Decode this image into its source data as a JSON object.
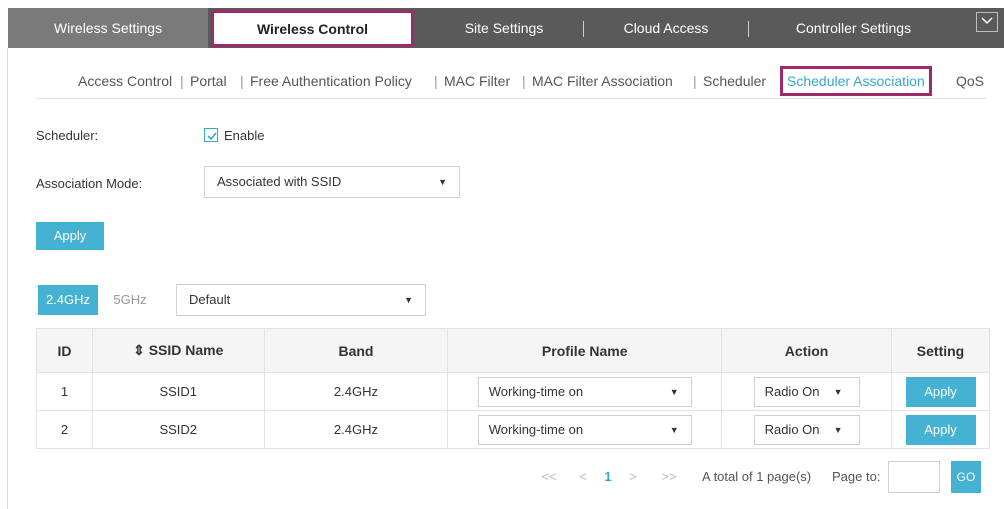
{
  "top_tabs": {
    "wireless_settings": "Wireless Settings",
    "wireless_control": "Wireless Control",
    "site_settings": "Site Settings",
    "cloud_access": "Cloud Access",
    "controller_settings": "Controller Settings",
    "expand_icon": "chevron-down-icon"
  },
  "sub_nav": {
    "items": [
      "Access Control",
      "Portal",
      "Free Authentication Policy",
      "MAC Filter",
      "MAC Filter Association",
      "Scheduler",
      "Scheduler Association",
      "QoS"
    ],
    "separator": "|",
    "active": "Scheduler Association"
  },
  "form": {
    "scheduler_label": "Scheduler:",
    "enable_label": "Enable",
    "enable_checked": true,
    "association_mode_label": "Association Mode:",
    "association_mode_value": "Associated with SSID",
    "apply_label": "Apply"
  },
  "band_tabs": {
    "tab_24": "2.4GHz",
    "tab_5": "5GHz",
    "active": "2.4GHz",
    "group_select": "Default"
  },
  "table": {
    "headers": {
      "id": "ID",
      "ssid_name": "SSID Name",
      "sort_icon": "sort-icon",
      "band": "Band",
      "profile_name": "Profile Name",
      "action": "Action",
      "setting": "Setting"
    },
    "rows": [
      {
        "id": "1",
        "ssid": "SSID1",
        "band": "2.4GHz",
        "profile": "Working-time on",
        "action": "Radio On",
        "setting": "Apply"
      },
      {
        "id": "2",
        "ssid": "SSID2",
        "band": "2.4GHz",
        "profile": "Working-time on",
        "action": "Radio On",
        "setting": "Apply"
      }
    ]
  },
  "pagination": {
    "first": "<<",
    "prev": "<",
    "current": "1",
    "next": ">",
    "last": ">>",
    "total": "A total of 1 page(s)",
    "page_to": "Page to:",
    "go": "GO"
  },
  "colors": {
    "accent": "#45b2d3",
    "highlight_border": "#a0296c",
    "topbar": "#5a5a5a"
  }
}
